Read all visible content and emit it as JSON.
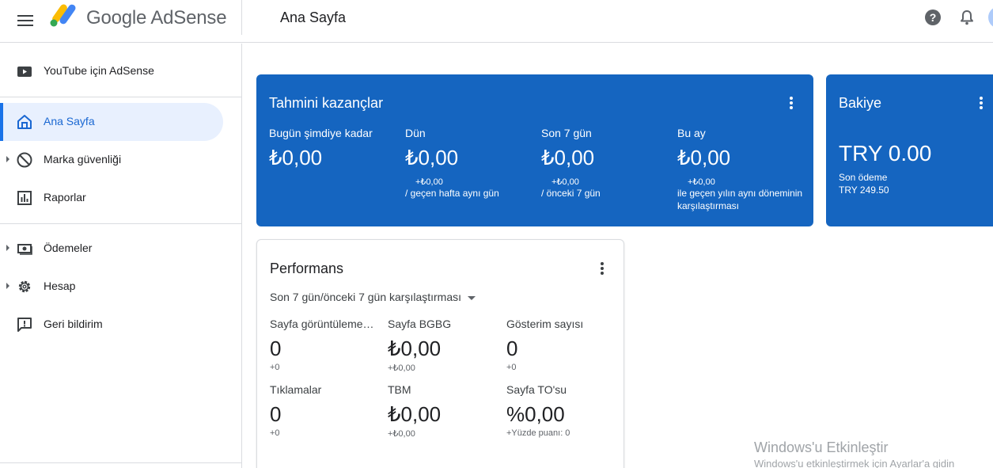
{
  "header": {
    "brand": "Google AdSense",
    "page_title": "Ana Sayfa",
    "icons": [
      "menu-icon",
      "adsense-logo",
      "help-icon",
      "bell-icon",
      "avatar"
    ]
  },
  "sidebar": {
    "items": [
      {
        "label": "YouTube için AdSense",
        "icon": "youtube-icon"
      },
      {
        "label": "Ana Sayfa",
        "icon": "home-icon",
        "active": true
      },
      {
        "label": "Marka güvenliği",
        "icon": "block-icon",
        "expandable": true
      },
      {
        "label": "Raporlar",
        "icon": "bar-chart-icon"
      },
      {
        "label": "Ödemeler",
        "icon": "payments-icon",
        "expandable": true
      },
      {
        "label": "Hesap",
        "icon": "gear-icon",
        "expandable": true
      },
      {
        "label": "Geri bildirim",
        "icon": "feedback-icon"
      }
    ]
  },
  "earnings": {
    "title": "Tahmini kazançlar",
    "metrics": [
      {
        "label": "Bugün şimdiye kadar",
        "value": "₺0,00",
        "delta": "",
        "note": ""
      },
      {
        "label": "Dün",
        "value": "₺0,00",
        "delta": "+₺0,00",
        "note": "/ geçen hafta aynı gün"
      },
      {
        "label": "Son 7 gün",
        "value": "₺0,00",
        "delta": "+₺0,00",
        "note": "/ önceki 7 gün"
      },
      {
        "label": "Bu ay",
        "value": "₺0,00",
        "delta": "+₺0,00",
        "note": "ile geçen yılın aynı döneminin karşılaştırması"
      }
    ]
  },
  "balance": {
    "title": "Bakiye",
    "value": "TRY 0.00",
    "last_payment_label": "Son ödeme",
    "last_payment_value": "TRY 249.50"
  },
  "performance": {
    "title": "Performans",
    "filter": "Son 7 gün/önceki 7 gün karşılaştırması",
    "metrics": [
      {
        "label": "Sayfa görüntülemeleri",
        "value": "0",
        "delta": "+0"
      },
      {
        "label": "Sayfa BGBG",
        "value": "₺0,00",
        "delta": "+₺0,00"
      },
      {
        "label": "Gösterim sayısı",
        "value": "0",
        "delta": "+0"
      },
      {
        "label": "Tıklamalar",
        "value": "0",
        "delta": "+0"
      },
      {
        "label": "TBM",
        "value": "₺0,00",
        "delta": "+₺0,00"
      },
      {
        "label": "Sayfa TO'su",
        "value": "%0,00",
        "delta": "+Yüzde puanı: 0"
      }
    ]
  },
  "watermark": {
    "line1": "Windows'u Etkinleştir",
    "line2": "Windows'u etkinleştirmek için Ayarlar'a gidin"
  },
  "colors": {
    "accent": "#1a73e8",
    "card_blue": "#1565c0",
    "active_bg": "#e8f0fe"
  }
}
